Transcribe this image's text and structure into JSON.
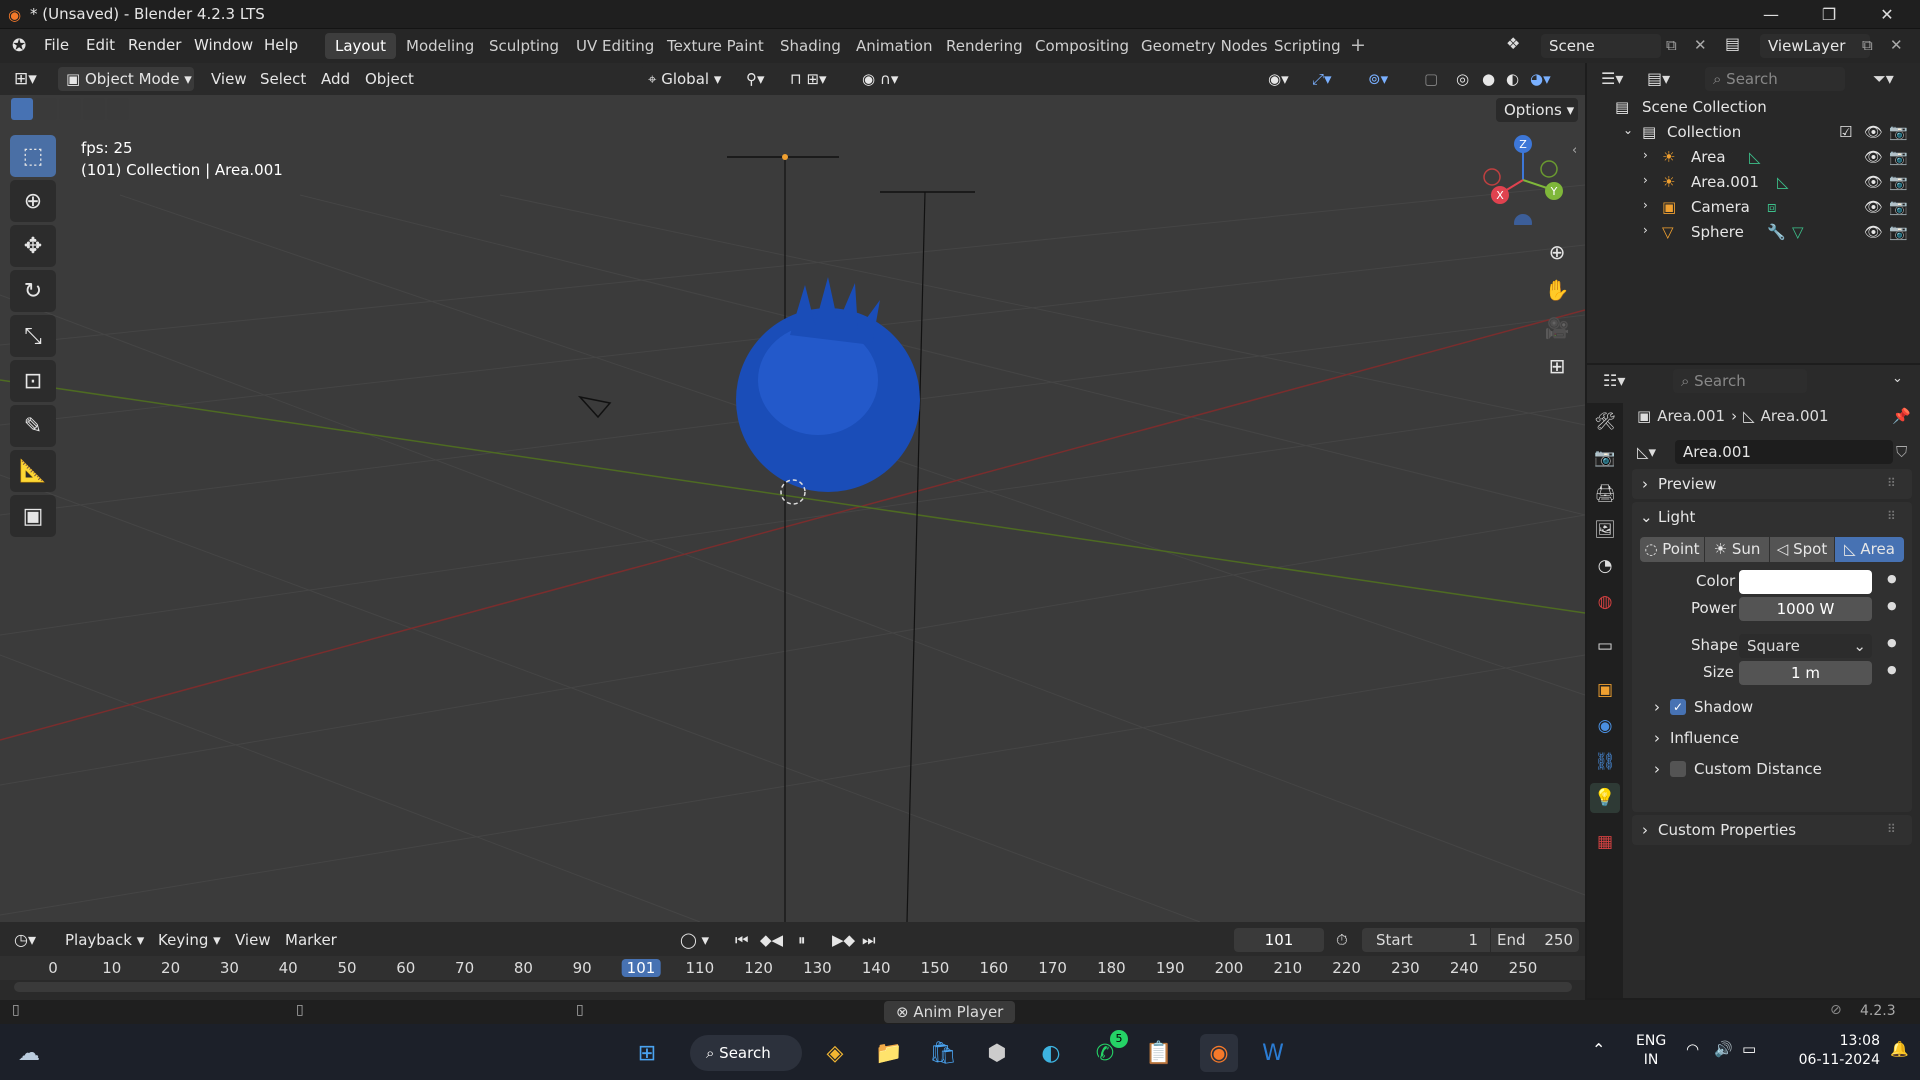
{
  "window": {
    "title": "* (Unsaved) - Blender 4.2.3 LTS"
  },
  "menus": [
    "File",
    "Edit",
    "Render",
    "Window",
    "Help"
  ],
  "workspaces": [
    "Layout",
    "Modeling",
    "Sculpting",
    "UV Editing",
    "Texture Paint",
    "Shading",
    "Animation",
    "Rendering",
    "Compositing",
    "Geometry Nodes",
    "Scripting"
  ],
  "active_workspace": "Layout",
  "scene": {
    "name": "Scene",
    "view_layer": "ViewLayer"
  },
  "viewport_header": {
    "mode": "Object Mode",
    "menus": [
      "View",
      "Select",
      "Add",
      "Object"
    ],
    "orientation": "Global",
    "options_label": "Options"
  },
  "overlay": {
    "fps": "fps: 25",
    "info": "(101) Collection | Area.001"
  },
  "gizmo": {
    "z": "Z",
    "y": "Y",
    "x": "X"
  },
  "outliner": {
    "search_placeholder": "Search",
    "root": "Scene Collection",
    "collection": "Collection",
    "items": [
      "Area",
      "Area.001",
      "Camera",
      "Sphere"
    ]
  },
  "properties": {
    "search_placeholder": "Search",
    "breadcrumb": [
      "Area.001",
      "Area.001"
    ],
    "datablock": "Area.001",
    "sections": {
      "preview": "Preview",
      "light": "Light",
      "shadow": "Shadow",
      "influence": "Influence",
      "custom_distance": "Custom Distance",
      "custom_properties": "Custom Properties"
    },
    "light_types": [
      "Point",
      "Sun",
      "Spot",
      "Area"
    ],
    "active_light_type": "Area",
    "color_label": "Color",
    "color_value": "#ffffff",
    "power_label": "Power",
    "power_value": "1000 W",
    "shape_label": "Shape",
    "shape_value": "Square",
    "size_label": "Size",
    "size_value": "1 m",
    "shadow_checked": true,
    "custom_distance_checked": false
  },
  "timeline": {
    "menus": [
      "Playback",
      "Keying",
      "View",
      "Marker"
    ],
    "current_frame": "101",
    "start_label": "Start",
    "start": "1",
    "end_label": "End",
    "end": "250",
    "ticks": [
      "0",
      "10",
      "20",
      "30",
      "40",
      "50",
      "60",
      "70",
      "80",
      "90",
      "101",
      "110",
      "120",
      "130",
      "140",
      "150",
      "160",
      "170",
      "180",
      "190",
      "200",
      "210",
      "220",
      "230",
      "240",
      "250"
    ]
  },
  "status": {
    "center": "Anim Player",
    "version": "4.2.3"
  },
  "taskbar": {
    "search": "Search",
    "lang": "ENG",
    "region": "IN",
    "time": "13:08",
    "date": "06-11-2024",
    "whatsapp_badge": "5"
  },
  "colors": {
    "accent": "#4772b3",
    "fur": "#1a4db8"
  }
}
